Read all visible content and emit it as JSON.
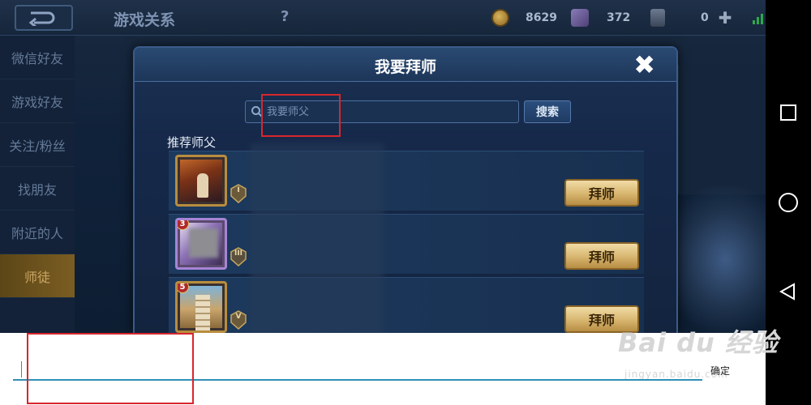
{
  "topbar": {
    "title": "游戏关系",
    "help": "?",
    "gold": "8629",
    "diamonds": "372",
    "cards": "0",
    "plus": "✚"
  },
  "sidebar": {
    "items": [
      {
        "label": "微信好友",
        "active": false
      },
      {
        "label": "游戏好友",
        "active": false
      },
      {
        "label": "关注/粉丝",
        "active": false
      },
      {
        "label": "找朋友",
        "active": false
      },
      {
        "label": "附近的人",
        "active": false
      },
      {
        "label": "师徒",
        "active": true
      }
    ]
  },
  "dialog": {
    "title": "我要拜师",
    "close": "✖",
    "search_placeholder": "我要师父",
    "search_button": "搜索",
    "section_label": "推荐师父",
    "rows": [
      {
        "level": "",
        "rank": "I",
        "button": "拜师"
      },
      {
        "level": "3",
        "rank": "III",
        "button": "拜师"
      },
      {
        "level": "5",
        "rank": "V",
        "button": "拜师"
      }
    ]
  },
  "ime": {
    "confirm": "确定"
  },
  "watermark": {
    "main": "Bai du 经验",
    "sub": "jingyan.baidu.com"
  },
  "colors": {
    "accent_gold": "#d7b56f",
    "highlight_red": "#d8262c",
    "ime_line": "#2f8fb7"
  }
}
